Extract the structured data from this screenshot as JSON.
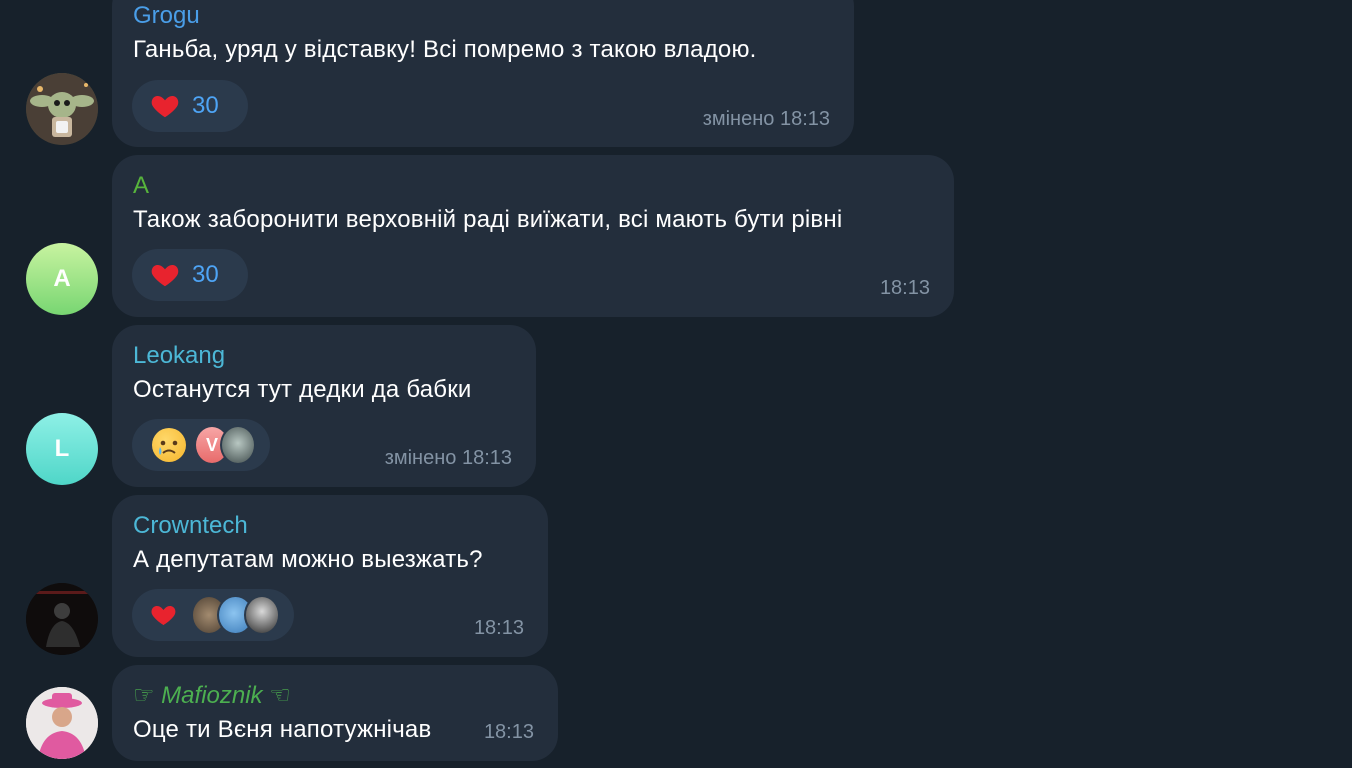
{
  "messages": [
    {
      "sender": "Grogu",
      "text": "Ганьба, уряд у відставку! Всі помремо з такою владою.",
      "reaction_count": "30",
      "time": "змінено 18:13"
    },
    {
      "sender": "A",
      "avatar_letter": "A",
      "text": "Також заборонити верховній раді виїжати, всі мають бути рівні",
      "reaction_count": "30",
      "time": "18:13"
    },
    {
      "sender": "Leokang",
      "avatar_letter": "L",
      "text": "Останутся тут дедки да бабки",
      "reactor_letter": "V",
      "time": "змінено 18:13"
    },
    {
      "sender": "Crowntech",
      "text": "А депутатам можно выезжать?",
      "time": "18:13"
    },
    {
      "sender": "☞ Mafioznik ☜",
      "text": "Оце ти Вєня напотужнічав",
      "time": "18:13"
    }
  ],
  "colors": {
    "background": "#17212b",
    "bubble": "#232e3c",
    "reaction_pill": "#2b3a4c",
    "accent": "#4ea4f5",
    "time": "#8393a4",
    "sender_grogu": "#4a9ee8",
    "sender_a": "#57b43c",
    "sender_leokang": "#4cb7d6",
    "sender_crowntech": "#4cb7d6",
    "sender_mafioznik": "#4caf50"
  },
  "icons": {
    "reaction_heart": "heart-icon",
    "reaction_cry": "crying-face-icon"
  }
}
